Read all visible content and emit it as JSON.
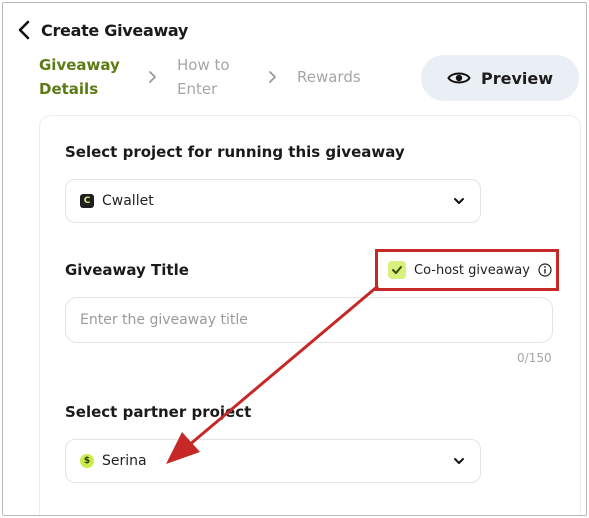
{
  "header": {
    "title": "Create Giveaway"
  },
  "steps": [
    {
      "label": "Giveaway Details"
    },
    {
      "label": "How to Enter"
    },
    {
      "label": "Rewards"
    }
  ],
  "preview": {
    "label": "Preview"
  },
  "project": {
    "label": "Select project for running this giveaway",
    "value": "Cwallet",
    "logo_text": "C"
  },
  "giveaway_title": {
    "label": "Giveaway Title",
    "placeholder": "Enter the giveaway title",
    "counter": "0/150"
  },
  "cohost": {
    "label": "Co-host giveaway",
    "checked": true
  },
  "partner": {
    "label": "Select partner project",
    "value": "Serina",
    "logo_text": "$"
  },
  "colors": {
    "accent": "#5d7a14",
    "checkbox": "#d8f07e",
    "annotation": "#c62828",
    "preview_bg": "#eaeef5"
  },
  "icons": [
    "back-arrow-icon",
    "chevron-right-icon",
    "eye-icon",
    "chevron-down-icon",
    "check-icon",
    "info-icon"
  ]
}
